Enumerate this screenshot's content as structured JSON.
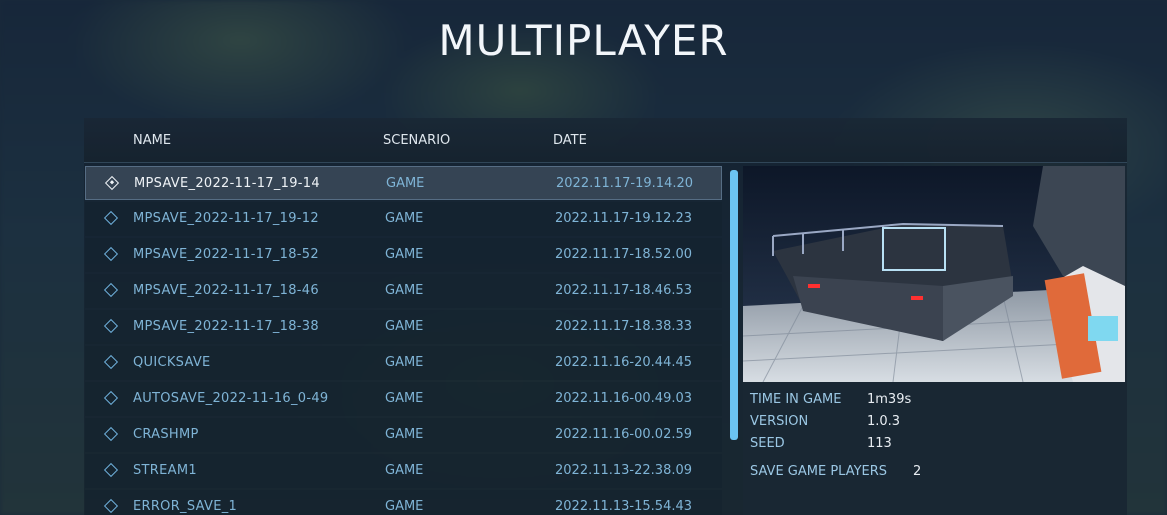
{
  "title": "MULTIPLAYER",
  "columns": {
    "name": "NAME",
    "scenario": "SCENARIO",
    "date": "DATE"
  },
  "saves": [
    {
      "name": "MPSAVE_2022-11-17_19-14",
      "scenario": "GAME",
      "date": "2022.11.17-19.14.20",
      "selected": true
    },
    {
      "name": "MPSAVE_2022-11-17_19-12",
      "scenario": "GAME",
      "date": "2022.11.17-19.12.23"
    },
    {
      "name": "MPSAVE_2022-11-17_18-52",
      "scenario": "GAME",
      "date": "2022.11.17-18.52.00"
    },
    {
      "name": "MPSAVE_2022-11-17_18-46",
      "scenario": "GAME",
      "date": "2022.11.17-18.46.53"
    },
    {
      "name": "MPSAVE_2022-11-17_18-38",
      "scenario": "GAME",
      "date": "2022.11.17-18.38.33"
    },
    {
      "name": "QUICKSAVE",
      "scenario": "GAME",
      "date": "2022.11.16-20.44.45"
    },
    {
      "name": "AUTOSAVE_2022-11-16_0-49",
      "scenario": "GAME",
      "date": "2022.11.16-00.49.03"
    },
    {
      "name": "CRASHMP",
      "scenario": "GAME",
      "date": "2022.11.16-00.02.59"
    },
    {
      "name": "STREAM1",
      "scenario": "GAME",
      "date": "2022.11.13-22.38.09"
    },
    {
      "name": "ERROR_SAVE_1",
      "scenario": "GAME",
      "date": "2022.11.13-15.54.43"
    }
  ],
  "details": {
    "time_in_game_label": "TIME IN GAME",
    "time_in_game": "1m39s",
    "version_label": "VERSION",
    "version": "1.0.3",
    "seed_label": "SEED",
    "seed": "113",
    "players_label": "SAVE GAME PLAYERS",
    "players": "2"
  },
  "colors": {
    "accent": "#6cc4f2",
    "text_dim": "#7fb4d6",
    "text_bright": "#eef2f6"
  },
  "icons": {
    "save_item": "diamond-icon"
  }
}
